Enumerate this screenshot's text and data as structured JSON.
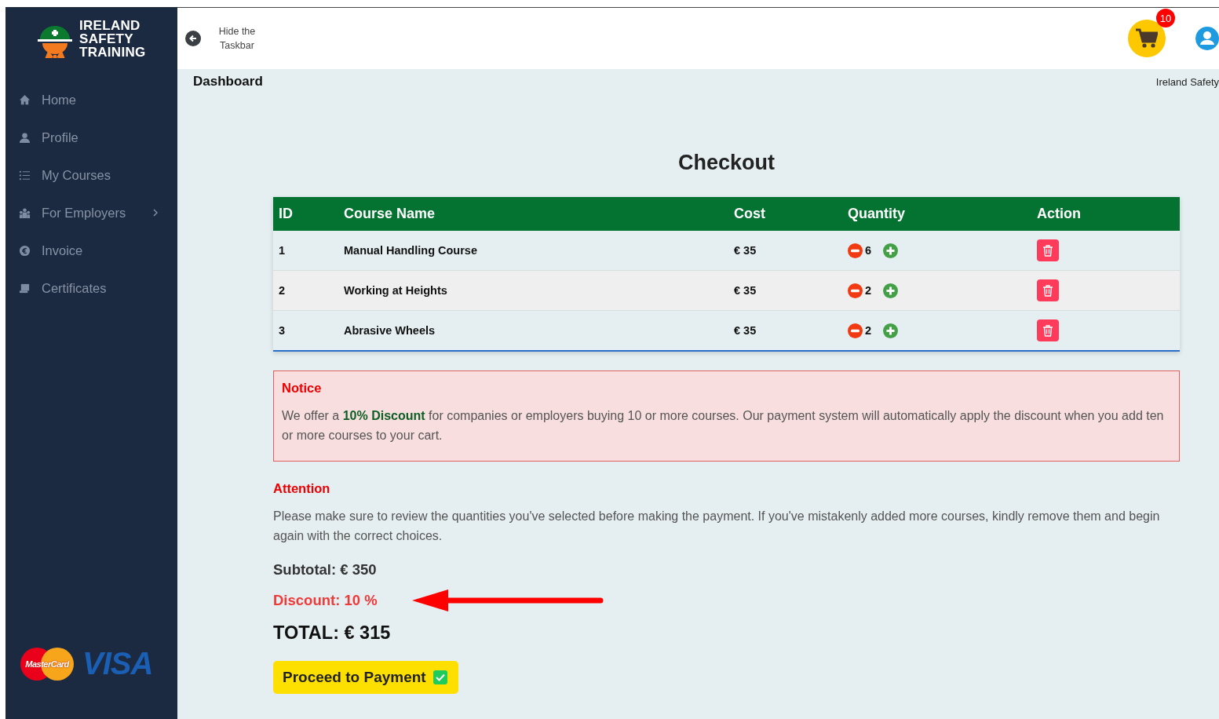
{
  "sidebar": {
    "logo": [
      "IRELAND",
      "SAFETY",
      "TRAINING"
    ],
    "items": [
      {
        "label": "Home",
        "has_submenu": false
      },
      {
        "label": "Profile",
        "has_submenu": false
      },
      {
        "label": "My Courses",
        "has_submenu": false
      },
      {
        "label": "For Employers",
        "has_submenu": true
      },
      {
        "label": "Invoice",
        "has_submenu": false
      },
      {
        "label": "Certificates",
        "has_submenu": false
      }
    ],
    "payment_logos": [
      "MasterCard",
      "VISA"
    ]
  },
  "header": {
    "toggle_label": "Hide the Taskbar",
    "cart_count": "10"
  },
  "breadcrumb": {
    "title": "Dashboard",
    "site": "Ireland Safety"
  },
  "checkout": {
    "title": "Checkout",
    "columns": [
      "ID",
      "Course Name",
      "Cost",
      "Quantity",
      "Action"
    ],
    "rows": [
      {
        "id": "1",
        "course": "Manual Handling Course",
        "cost": "€ 35",
        "quantity": "6"
      },
      {
        "id": "2",
        "course": "Working at Heights",
        "cost": "€ 35",
        "quantity": "2"
      },
      {
        "id": "3",
        "course": "Abrasive Wheels",
        "cost": "€ 35",
        "quantity": "2"
      }
    ],
    "notice": {
      "heading": "Notice",
      "text": "We offer a **10% Discount** for companies or employers buying 10 or more courses. Our payment system will automatically apply the discount when you add ten or more courses to your cart."
    },
    "attention": {
      "heading": "Attention",
      "text": "Please make sure to review the quantities you've selected before making the payment. If you've mistakenly added more courses, kindly remove them and begin again with the correct choices."
    },
    "subtotal": "Subtotal: € 350",
    "discount": "Discount: 10 %",
    "total": "TOTAL: € 315",
    "pay_button": "Proceed to Payment"
  }
}
